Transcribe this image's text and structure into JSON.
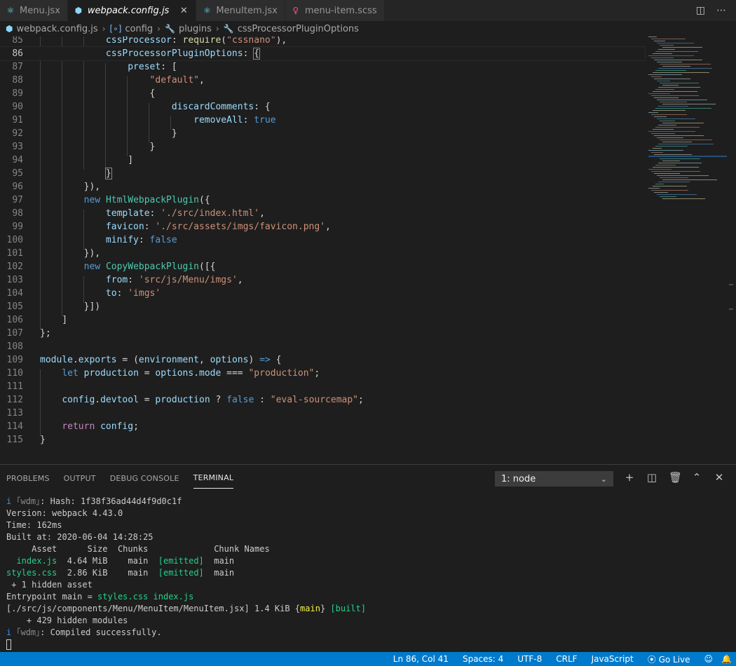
{
  "tabs": [
    {
      "label": "Menu.jsx",
      "icon": "react-icon",
      "icon_color": "#61dafb",
      "active": false
    },
    {
      "label": "webpack.config.js",
      "icon": "webpack-icon",
      "icon_color": "#8dd6f9",
      "active": true
    },
    {
      "label": "MenuItem.jsx",
      "icon": "react-icon",
      "icon_color": "#61dafb",
      "active": false
    },
    {
      "label": "menu-item.scss",
      "icon": "sass-icon",
      "icon_color": "#f55385",
      "active": false
    }
  ],
  "breadcrumb": {
    "file": "webpack.config.js",
    "items": [
      "config",
      "plugins",
      "cssProcessorPluginOptions"
    ]
  },
  "editor": {
    "current_line": 86,
    "lines": [
      {
        "n": "85",
        "html": "            <span class=\"p\">cssProcessor</span>: <span class=\"f\">require</span>(<span class=\"s\">\"cssnano\"</span>),"
      },
      {
        "n": "86",
        "html": "            <span class=\"p\">cssProcessorPluginOptions</span>: <span class=\"bracket-hl\">{</span>"
      },
      {
        "n": "87",
        "html": "                <span class=\"p\">preset</span>: ["
      },
      {
        "n": "88",
        "html": "                    <span class=\"s\">\"default\"</span>,"
      },
      {
        "n": "89",
        "html": "                    {"
      },
      {
        "n": "90",
        "html": "                        <span class=\"p\">discardComments</span>: {"
      },
      {
        "n": "91",
        "html": "                            <span class=\"p\">removeAll</span>: <span class=\"k\">true</span>"
      },
      {
        "n": "92",
        "html": "                        }"
      },
      {
        "n": "93",
        "html": "                    }"
      },
      {
        "n": "94",
        "html": "                ]"
      },
      {
        "n": "95",
        "html": "            <span class=\"bracket-hl\">}</span>"
      },
      {
        "n": "96",
        "html": "        }),"
      },
      {
        "n": "97",
        "html": "        <span class=\"k\">new</span> <span class=\"c\">HtmlWebpackPlugin</span>({"
      },
      {
        "n": "98",
        "html": "            <span class=\"p\">template</span>: <span class=\"s\">'./src/index.html'</span>,"
      },
      {
        "n": "99",
        "html": "            <span class=\"p\">favicon</span>: <span class=\"s\">'./src/assets/imgs/favicon.png'</span>,"
      },
      {
        "n": "100",
        "html": "            <span class=\"p\">minify</span>: <span class=\"k\">false</span>"
      },
      {
        "n": "101",
        "html": "        }),"
      },
      {
        "n": "102",
        "html": "        <span class=\"k\">new</span> <span class=\"c\">CopyWebpackPlugin</span>([{"
      },
      {
        "n": "103",
        "html": "            <span class=\"p\">from</span>: <span class=\"s\">'src/js/Menu/imgs'</span>,"
      },
      {
        "n": "104",
        "html": "            <span class=\"p\">to</span>: <span class=\"s\">'imgs'</span>"
      },
      {
        "n": "105",
        "html": "        }])"
      },
      {
        "n": "106",
        "html": "    ]"
      },
      {
        "n": "107",
        "html": "};"
      },
      {
        "n": "108",
        "html": ""
      },
      {
        "n": "109",
        "html": "<span class=\"p\">module</span>.<span class=\"p\">exports</span> = (<span class=\"p\">environment</span>, <span class=\"p\">options</span>) <span class=\"k\">=&gt;</span> {"
      },
      {
        "n": "110",
        "html": "    <span class=\"k\">let</span> <span class=\"p\">production</span> = <span class=\"p\">options</span>.<span class=\"p\">mode</span> === <span class=\"s\">\"production\"</span>;"
      },
      {
        "n": "111",
        "html": ""
      },
      {
        "n": "112",
        "html": "    <span class=\"p\">config</span>.<span class=\"p\">devtool</span> = <span class=\"p\">production</span> ? <span class=\"k\">false</span> : <span class=\"s\">\"eval-sourcemap\"</span>;"
      },
      {
        "n": "113",
        "html": ""
      },
      {
        "n": "114",
        "html": "    <span class=\"kw\">return</span> <span class=\"p\">config</span>;"
      },
      {
        "n": "115",
        "html": "}"
      }
    ]
  },
  "panel": {
    "tabs": [
      {
        "label": "PROBLEMS",
        "active": false
      },
      {
        "label": "OUTPUT",
        "active": false
      },
      {
        "label": "DEBUG CONSOLE",
        "active": false
      },
      {
        "label": "TERMINAL",
        "active": true
      }
    ],
    "terminal_select": "1: node",
    "terminal_lines": [
      "<span class=\"t-blue\">i</span> <span class=\"t-dim\">｢wdm｣</span>: Hash: 1f38f36ad44d4f9d0c1f",
      "Version: webpack 4.43.0",
      "Time: 162ms",
      "Built at: 2020-06-04 14:28:25",
      "     Asset      Size  Chunks             Chunk Names",
      "  <span class=\"t-green\">index.js</span>  4.64 MiB    main  <span class=\"t-green\">[emitted]</span>  main",
      "<span class=\"t-green\">styles.css</span>  2.86 KiB    main  <span class=\"t-green\">[emitted]</span>  main",
      " + 1 hidden asset",
      "Entrypoint main = <span class=\"t-green\">styles.css</span> <span class=\"t-green\">index.js</span>",
      "[./src/js/components/Menu/MenuItem/MenuItem.jsx] 1.4 KiB {<span class=\"t-yellow\">main</span>} <span class=\"t-green\">[built]</span>",
      "    + 429 hidden modules",
      "<span class=\"t-blue\">i</span> <span class=\"t-dim\">｢wdm｣</span>: Compiled successfully."
    ]
  },
  "statusbar": {
    "position": "Ln 86, Col 41",
    "spaces": "Spaces: 4",
    "encoding": "UTF-8",
    "eol": "CRLF",
    "language": "JavaScript",
    "golive": "Go Live"
  },
  "colors": {
    "status_bg": "#007acc",
    "editor_bg": "#1e1e1e"
  }
}
